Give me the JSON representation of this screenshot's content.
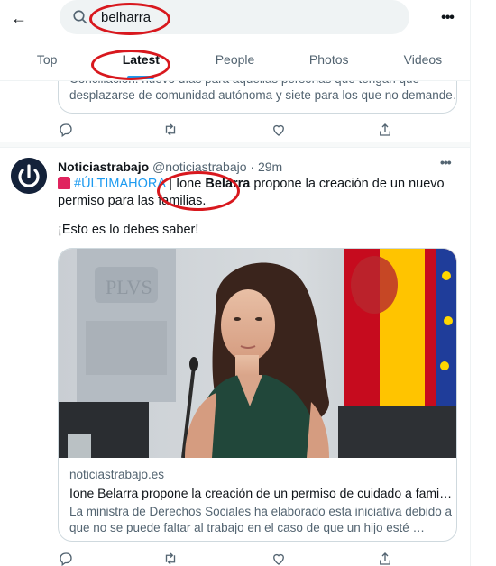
{
  "header": {
    "back_icon": "arrow-left-icon",
    "search_value": "belharra",
    "more_icon": "more-horizontal-icon"
  },
  "tabs": [
    {
      "label": "Top",
      "active": false
    },
    {
      "label": "Latest",
      "active": true
    },
    {
      "label": "People",
      "active": false
    },
    {
      "label": "Photos",
      "active": false
    },
    {
      "label": "Videos",
      "active": false
    }
  ],
  "prev_tweet": {
    "line1": "Conciliación: nuevo días para aquellas personas que tengan que",
    "line2": "desplazarse de comunidad autónoma y siete para los que no demande…"
  },
  "tweet": {
    "name": "Noticiastrabajo",
    "handle": "@noticiastrabajo",
    "time": "· 29m",
    "hashtag": "#ÚLTIMAHORA",
    "text_before": " | Ione ",
    "text_bold": "Belarra",
    "text_after": " propone la creación de un nuevo permiso para las familias.",
    "text2": "¡Esto es lo debes saber!",
    "card": {
      "domain": "noticiastrabajo.es",
      "title": "Ione Belarra propone la creación de un permiso de cuidado a familiare…",
      "description": "La ministra de Derechos Sociales ha elaborado esta iniciativa debido a que no se puede faltar al trabajo en el caso de que un hijo esté …",
      "image_text": "PLVS"
    }
  },
  "colors": {
    "accent": "#1d9bf0",
    "annotation": "#d8181e",
    "secondary_text": "#536471"
  }
}
